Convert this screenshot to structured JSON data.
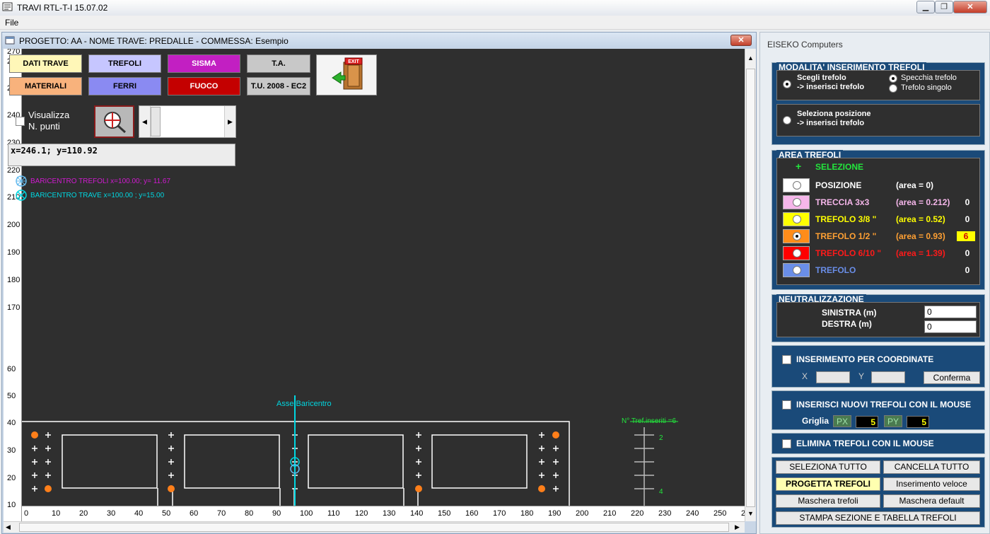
{
  "window": {
    "title": "TRAVI RTL-T-I  15.07.02",
    "min": "▁",
    "max": "❐",
    "close": "✕"
  },
  "menu": {
    "file": "File"
  },
  "child": {
    "title": "PROGETTO: AA - NOME TRAVE: PREDALLE - COMMESSA: Esempio",
    "close": "✕"
  },
  "toolbar": {
    "dati_trave": "DATI TRAVE",
    "trefoli": "TREFOLI",
    "sisma": "SISMA",
    "ta": "T.A.",
    "materiali": "MATERIALI",
    "ferri": "FERRI",
    "fuoco": "FUOCO",
    "tu2008": "T.U. 2008 - EC2",
    "exit": "EXIT",
    "visualizza": "Visualizza",
    "n_punti": "N. punti",
    "coords": "x=246.1; y=110.92"
  },
  "legend": {
    "baricentro_trefoli": "BARICENTRO TREFOLI  x=100.00; y= 11.67",
    "baricentro_trave": "BARICENTRO TRAVE  x=100.00 ; y=15.00"
  },
  "drawing": {
    "asse_label": "Asse Baricentro",
    "inseriti_label": "N° Tref.inseriti =6",
    "scale_marks": [
      "2",
      "4"
    ],
    "colors": {
      "canvas": "#2f2f2f",
      "outline": "#ffffff",
      "axis": "#00d6e0",
      "strand": "#ff7f1a",
      "text_green": "#22e63c",
      "magenta": "#d01ad0"
    }
  },
  "y_ticks": [
    "270",
    "260",
    "250",
    "240",
    "230",
    "220",
    "210",
    "200",
    "190",
    "180",
    "170",
    "60",
    "50",
    "40",
    "30",
    "20",
    "10",
    "0"
  ],
  "x_ticks": [
    "0",
    "10",
    "20",
    "30",
    "40",
    "50",
    "60",
    "70",
    "80",
    "90",
    "100",
    "110",
    "120",
    "130",
    "140",
    "150",
    "160",
    "170",
    "180",
    "190",
    "200",
    "210",
    "220",
    "230",
    "240",
    "250",
    "26"
  ],
  "panel": {
    "company": "EISEKO Computers",
    "modalita": {
      "title": "MODALITA' INSERIMENTO TREFOLI",
      "opt1_line1": "Scegli trefolo",
      "opt1_line2": "-> inserisci trefolo",
      "specchia": "Specchia trefolo",
      "singolo": "Trefolo singolo",
      "opt2_line1": "Seleziona posizione",
      "opt2_line2": "-> inserisci trefolo"
    },
    "area": {
      "title": "AREA TREFOLI",
      "plus": "+",
      "selezione": "SELEZIONE",
      "rows": [
        {
          "name": "POSIZIONE",
          "area": "(area = 0)",
          "count": "",
          "color": "#ffffff",
          "text": "#ffffff"
        },
        {
          "name": "TRECCIA  3x3",
          "area": "(area = 0.212)",
          "count": "0",
          "color": "#f5b6ea",
          "text": "#f5b6ea"
        },
        {
          "name": "TREFOLO 3/8 \"",
          "area": "(area = 0.52)",
          "count": "0",
          "color": "#ffff00",
          "text": "#ffff00"
        },
        {
          "name": "TREFOLO 1/2 \"",
          "area": "(area = 0.93)",
          "count": "6",
          "color": "#ff8c1a",
          "text": "#ffa033"
        },
        {
          "name": "TREFOLO 6/10 \"",
          "area": "(area = 1.39)",
          "count": "0",
          "color": "#ff0000",
          "text": "#ff1a1a"
        },
        {
          "name": "TREFOLO",
          "area": "",
          "count": "0",
          "color": "#6a8ee8",
          "text": "#6a8ee8"
        }
      ]
    },
    "neutral": {
      "title": "NEUTRALIZZAZIONE",
      "sinistra": "SINISTRA (m)",
      "destra": "DESTRA (m)",
      "sinistra_val": "0",
      "destra_val": "0"
    },
    "coord": {
      "label": "INSERIMENTO PER COORDINATE",
      "x": "X",
      "y": "Y",
      "conferma": "Conferma"
    },
    "mouse_ins": {
      "label": "INSERISCI NUOVI TREFOLI CON IL MOUSE",
      "griglia": "Griglia",
      "px": "PX",
      "py": "PY",
      "px_val": "5",
      "py_val": "5"
    },
    "mouse_del": {
      "label": "ELIMINA TREFOLI CON IL MOUSE"
    },
    "buttons": {
      "seleziona": "SELEZIONA TUTTO",
      "cancella": "CANCELLA TUTTO",
      "progetta": "PROGETTA TREFOLI",
      "veloce": "Inserimento veloce",
      "maschera": "Maschera trefoli",
      "maschera_def": "Maschera default",
      "stampa": "STAMPA SEZIONE E TABELLA TREFOLI"
    }
  }
}
